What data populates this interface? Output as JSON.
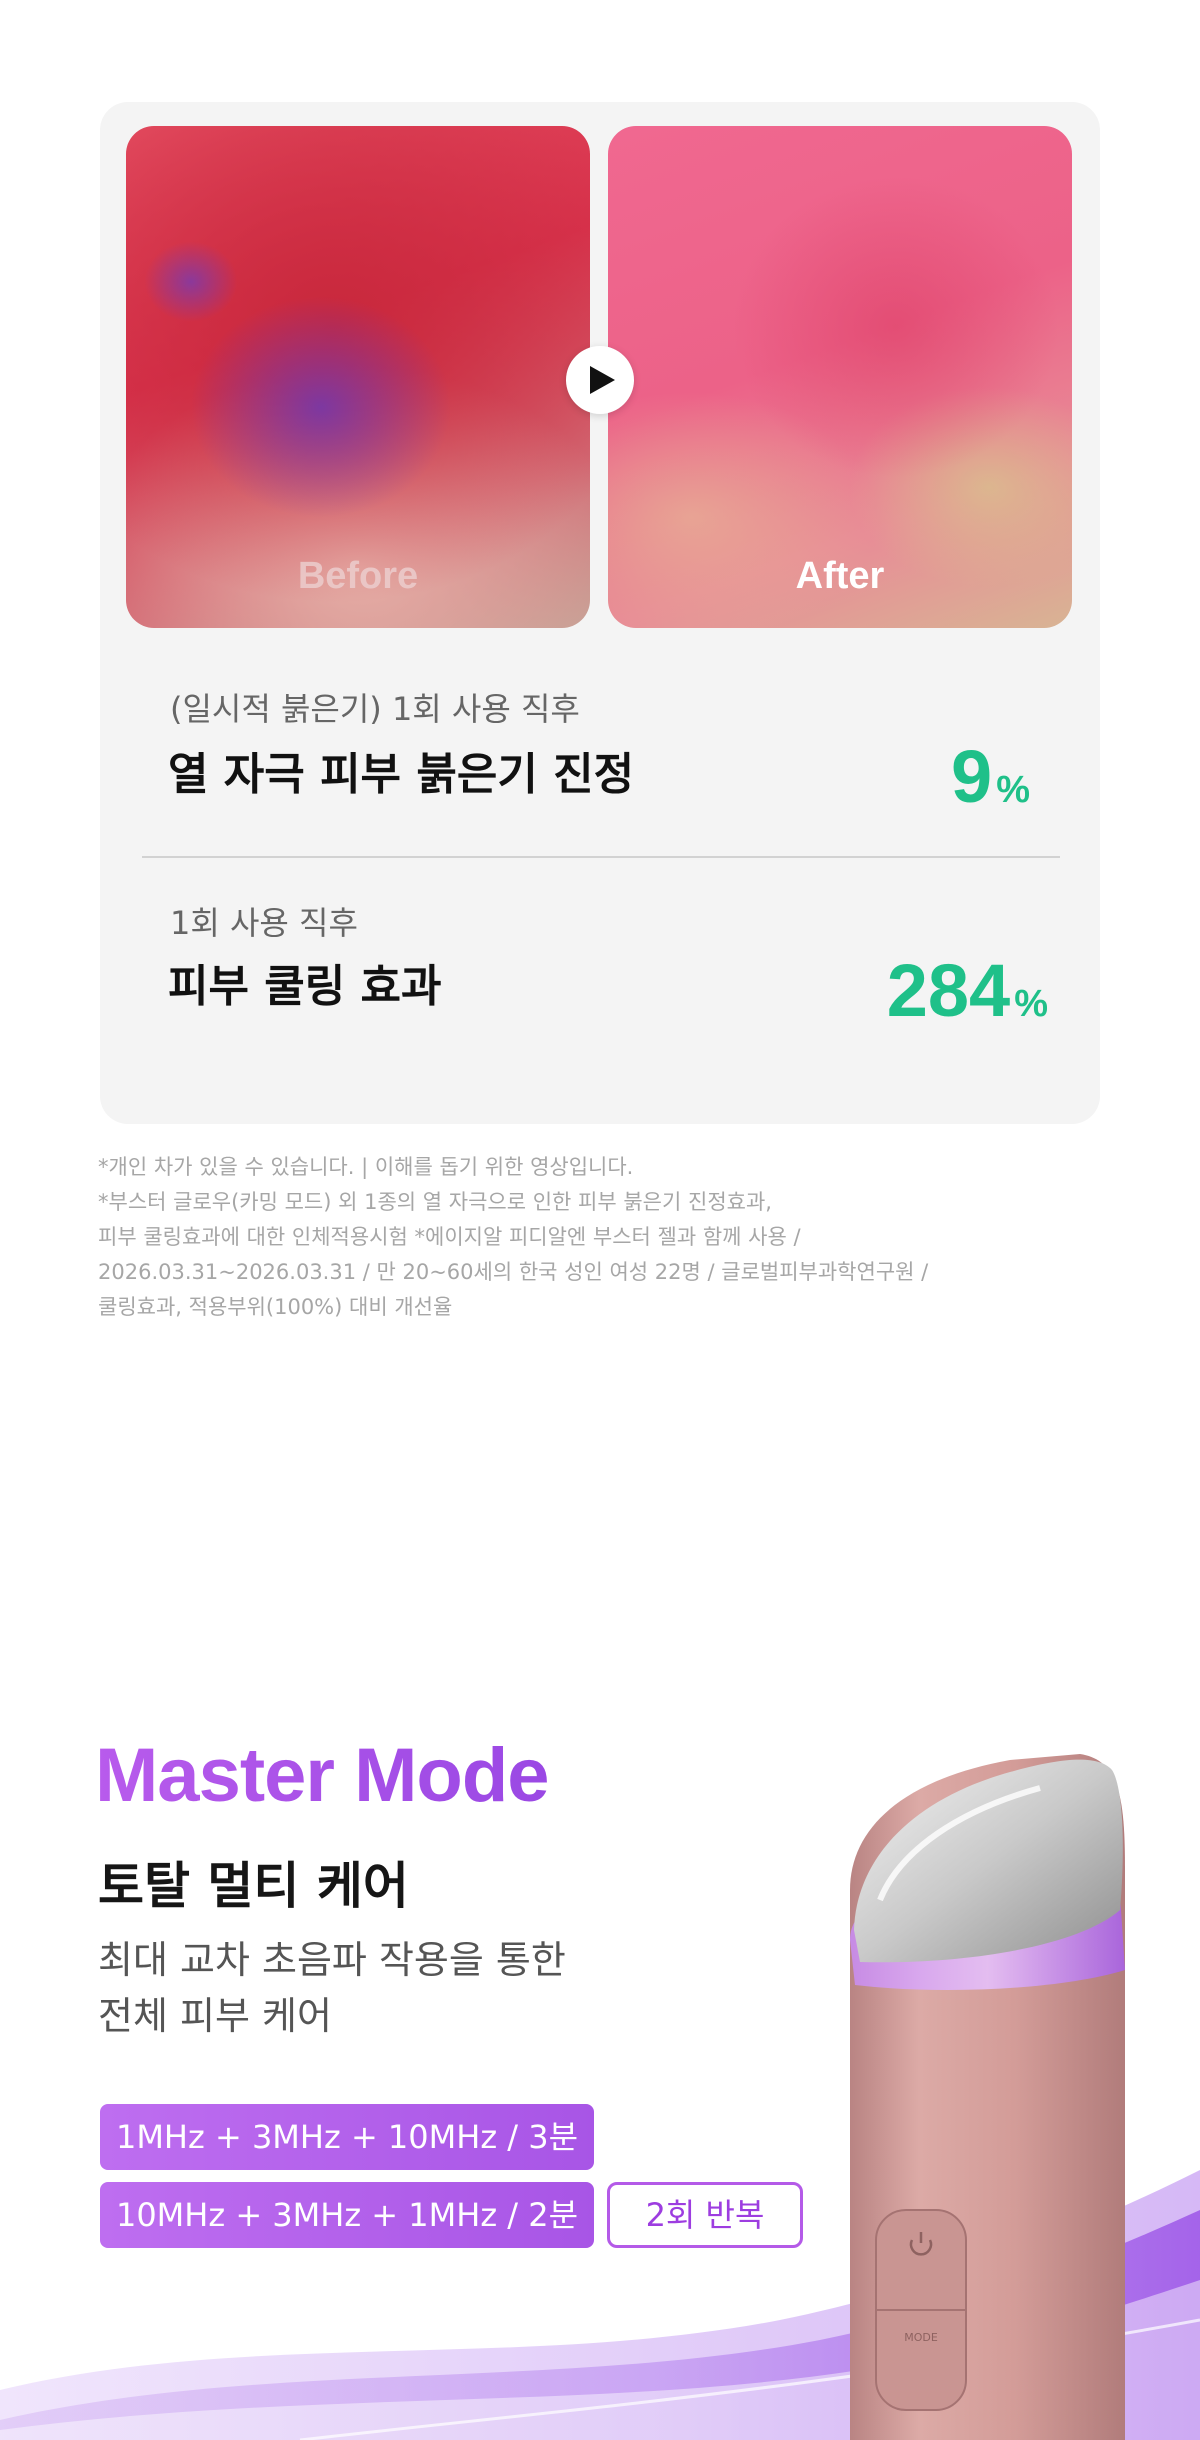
{
  "comparison": {
    "before_label": "Before",
    "after_label": "After"
  },
  "stats": [
    {
      "sub": "(일시적 붉은기) 1회 사용 직후",
      "title": "열 자극 피부 붉은기 진정",
      "value": "9",
      "unit": "%"
    },
    {
      "sub": "1회 사용 직후",
      "title": "피부 쿨링 효과",
      "value": "284",
      "unit": "%"
    }
  ],
  "notes": [
    "*개인 차가 있을 수 있습니다. | 이해를 돕기 위한 영상입니다.",
    "*부스터 글로우(카밍 모드) 외 1종의 열 자극으로 인한 피부 붉은기 진정효과,",
    " 피부 쿨링효과에 대한 인체적용시험 *에이지알 피디알엔 부스터 젤과 함께 사용 /",
    " 2026.03.31~2026.03.31 / 만 20~60세의 한국 성인 여성 22명 / 글로벌피부과학연구원 /",
    " 쿨링효과, 적용부위(100%) 대비 개선율"
  ],
  "master_mode": {
    "title": "Master Mode",
    "heading": "토탈 멀티 케어",
    "desc_lines": [
      "최대 교차 초음파 작용을 통한",
      "전체 피부 케어"
    ],
    "sequence_1": "1MHz + 3MHz + 10MHz / 3분",
    "sequence_2": "10MHz + 3MHz + 1MHz / 2분",
    "repeat": "2회 반복"
  },
  "device": {
    "mode_label": "MODE",
    "power_icon": "power-icon"
  },
  "colors": {
    "accent_green": "#1fc089",
    "accent_purple": "#a855e6",
    "card_bg": "#f4f4f4"
  }
}
